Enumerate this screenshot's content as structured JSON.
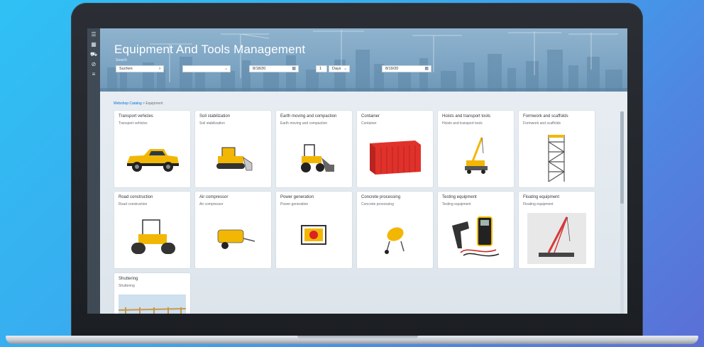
{
  "app": {
    "title": "Equipment And Tools Management"
  },
  "filters": {
    "search_label": "Search",
    "search_placeholder": "Suchen",
    "category_value": "",
    "from_date": "8/18/20",
    "duration_value": "1",
    "duration_unit": "Days",
    "to_date": "8/19/20"
  },
  "breadcrumb": {
    "link": "Webshop Catalog",
    "separator": ">",
    "current": "Equipment"
  },
  "tiles": [
    {
      "title": "Transport vehicles",
      "subtitle": "Transport vehicles",
      "icon": "pickup-truck"
    },
    {
      "title": "Soil stabilization",
      "subtitle": "Soil stabilization",
      "icon": "bulldozer"
    },
    {
      "title": "Earth moving and compaction",
      "subtitle": "Earth moving and compaction",
      "icon": "wheel-loader"
    },
    {
      "title": "Container",
      "subtitle": "Container",
      "icon": "shipping-container"
    },
    {
      "title": "Hoists and transport tools",
      "subtitle": "Hoists and transport tools",
      "icon": "mobile-crane"
    },
    {
      "title": "Formwork and scaffolds",
      "subtitle": "Formwork and scaffolds",
      "icon": "scaffold-tower"
    },
    {
      "title": "Road construction",
      "subtitle": "Road construction",
      "icon": "road-roller"
    },
    {
      "title": "Air compressor",
      "subtitle": "Air compressor",
      "icon": "air-compressor"
    },
    {
      "title": "Power generation",
      "subtitle": "Power generation",
      "icon": "generator"
    },
    {
      "title": "Concrete processing",
      "subtitle": "Concrete processing",
      "icon": "concrete-mixer"
    },
    {
      "title": "Testing equipment",
      "subtitle": "Testing equipment",
      "icon": "multimeter"
    },
    {
      "title": "Floating equipment",
      "subtitle": "Floating equipment",
      "icon": "floating-crane"
    },
    {
      "title": "Shuttering",
      "subtitle": "Shuttering",
      "icon": "timber-formwork"
    }
  ],
  "colors": {
    "accent": "#0a6ed1",
    "header": "#7ea6c4",
    "rail": "#3f4a55",
    "equipment_yellow": "#f2b705",
    "container_red": "#e0312b"
  }
}
